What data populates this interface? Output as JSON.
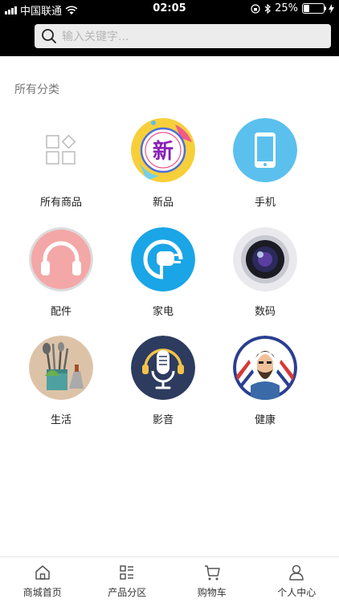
{
  "status_bar": {
    "carrier": "中国联通",
    "time": "02:05",
    "battery_text": "25%",
    "battery_level": 0.25
  },
  "search": {
    "placeholder": "输入关键字..."
  },
  "section_title": "所有分类",
  "categories": [
    {
      "label": "所有商品",
      "icon": "grid-icon"
    },
    {
      "label": "新品",
      "icon": "new-badge-icon"
    },
    {
      "label": "手机",
      "icon": "phone-icon"
    },
    {
      "label": "配件",
      "icon": "headphones-icon"
    },
    {
      "label": "家电",
      "icon": "plug-icon"
    },
    {
      "label": "数码",
      "icon": "camera-lens-icon"
    },
    {
      "label": "生活",
      "icon": "kitchen-tools-icon"
    },
    {
      "label": "影音",
      "icon": "microphone-icon"
    },
    {
      "label": "健康",
      "icon": "barber-icon"
    }
  ],
  "new_badge_text": "新",
  "tabbar": [
    {
      "label": "商城首页",
      "icon": "home-icon"
    },
    {
      "label": "产品分区",
      "icon": "category-list-icon"
    },
    {
      "label": "购物车",
      "icon": "cart-icon"
    },
    {
      "label": "个人中心",
      "icon": "user-icon"
    }
  ],
  "colors": {
    "header_bg": "#000000",
    "phone_circle": "#5bc0ee",
    "headphones_circle": "#f4a7a7",
    "plug_circle": "#1aa5e6",
    "mic_circle": "#2d3b5e",
    "new_circle": "#f7cf3a"
  }
}
